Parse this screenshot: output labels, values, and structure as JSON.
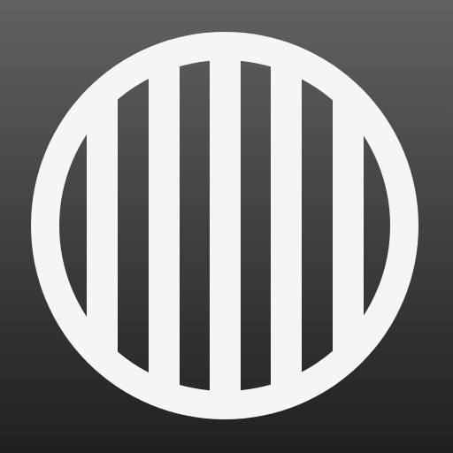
{
  "icon": {
    "name": "circle-with-vertical-stripes-icon",
    "colors": {
      "background_top": "#616161",
      "background_bottom": "#202020",
      "glyph": "#f5f5f5"
    }
  }
}
